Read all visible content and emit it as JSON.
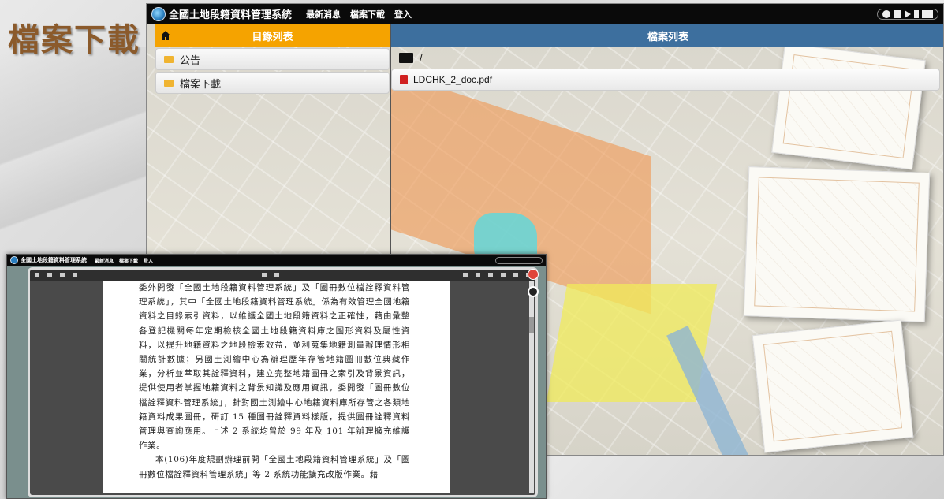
{
  "corner_title": "檔案下載",
  "app": {
    "brand": "全國土地段籍資料管理系統",
    "nav": [
      "最新消息",
      "檔案下載",
      "登入"
    ]
  },
  "left_panel": {
    "title": "目錄列表",
    "items": [
      {
        "label": "公告"
      },
      {
        "label": "檔案下載"
      }
    ]
  },
  "right_panel": {
    "title": "檔案列表",
    "path": "/",
    "files": [
      {
        "name": "LDCHK_2_doc.pdf"
      }
    ]
  },
  "inset": {
    "brand": "全國土地段籍資料管理系統",
    "nav": [
      "最新消息",
      "檔案下載",
      "登入"
    ],
    "pdf_text": [
      "委外開發「全國土地段籍資料管理系統」及「圖冊數位檔詮釋資料管理系統」，其中「全國土地段籍資料管理系統」係為有效管理全國地籍資料之目錄索引資料，以維護全國土地段籍資料之正確性，藉由彙整各登記機關每年定期檢核全國土地段籍資料庫之圖形資料及屬性資料，以提升地籍資料之地段檢索效益，並利蒐集地籍測量辦理情形相關統計數據；另國土測繪中心為辦理歷年存管地籍圖冊數位典藏作業，分析並萃取其詮釋資料，建立完整地籍圖冊之索引及背景資訊，提供使用者掌握地籍資料之背景知識及應用資訊，委開發「圖冊數位檔詮釋資料管理系統」，針對國土測繪中心地籍資料庫所存管之各類地籍資料成果圖冊，研訂 15 種圖冊詮釋資料樣版，提供圖冊詮釋資料管理與查詢應用。上述 2 系統均曾於 99 年及 101 年辦理擴充維護作業。",
      "本(106)年度規劃辦理前開「全國土地段籍資料管理系統」及「圖冊數位檔詮釋資料管理系統」等 2 系統功能擴充改版作業。藉"
    ]
  }
}
